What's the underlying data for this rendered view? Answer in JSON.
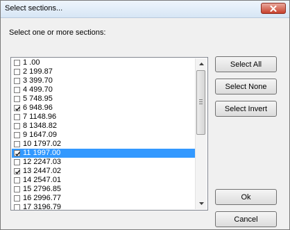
{
  "window": {
    "title": "Select sections...",
    "close_icon": "close-icon"
  },
  "prompt": "Select one or more sections:",
  "list": {
    "items": [
      {
        "label": "1 .00",
        "checked": false,
        "selected": false
      },
      {
        "label": "2 199.87",
        "checked": false,
        "selected": false
      },
      {
        "label": "3 399.70",
        "checked": false,
        "selected": false
      },
      {
        "label": "4 499.70",
        "checked": false,
        "selected": false
      },
      {
        "label": "5 748.95",
        "checked": false,
        "selected": false
      },
      {
        "label": "6 948.96",
        "checked": true,
        "selected": false
      },
      {
        "label": "7 1148.96",
        "checked": false,
        "selected": false
      },
      {
        "label": "8 1348.82",
        "checked": false,
        "selected": false
      },
      {
        "label": "9 1647.09",
        "checked": false,
        "selected": false
      },
      {
        "label": "10 1797.02",
        "checked": false,
        "selected": false
      },
      {
        "label": "11 1997.00",
        "checked": true,
        "selected": true
      },
      {
        "label": "12 2247.03",
        "checked": false,
        "selected": false
      },
      {
        "label": "13 2447.02",
        "checked": true,
        "selected": false
      },
      {
        "label": "14 2547.01",
        "checked": false,
        "selected": false
      },
      {
        "label": "15 2796.85",
        "checked": false,
        "selected": false
      },
      {
        "label": "16 2996.77",
        "checked": false,
        "selected": false
      },
      {
        "label": "17 3196.79",
        "checked": false,
        "selected": false
      }
    ],
    "scroll_fraction": 0
  },
  "buttons": {
    "select_all": "Select All",
    "select_none": "Select None",
    "select_invert": "Select Invert",
    "ok": "Ok",
    "cancel": "Cancel"
  },
  "colors": {
    "selection": "#3399ff",
    "close_button": "#c7402c"
  }
}
